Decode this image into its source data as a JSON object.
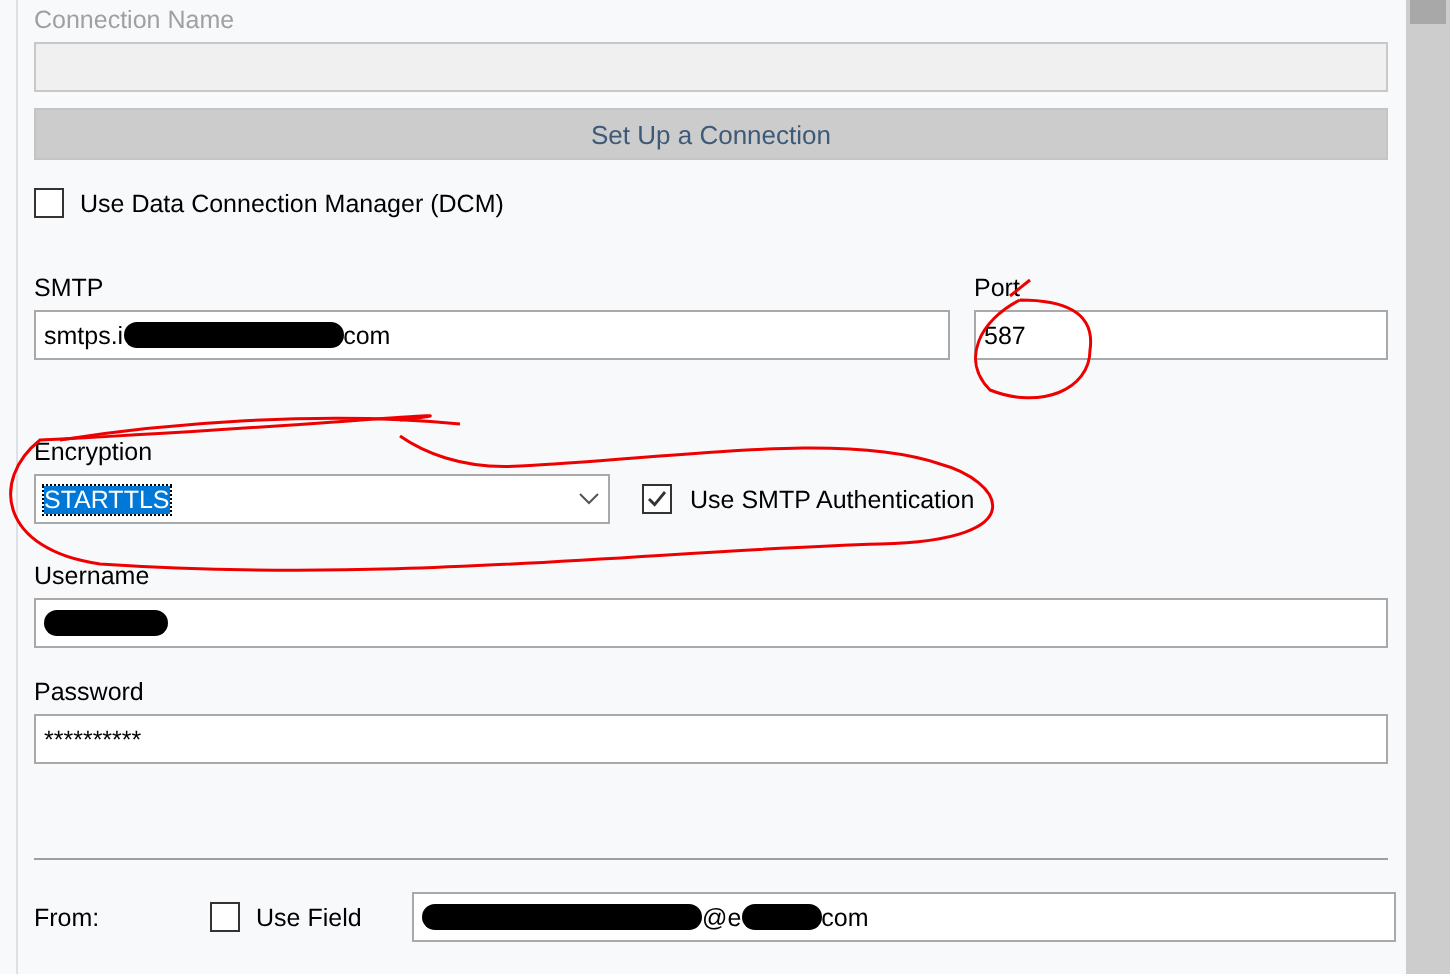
{
  "connection_name": {
    "label": "Connection Name",
    "disabled": true
  },
  "setup_button": {
    "label": "Set Up a Connection",
    "disabled": true
  },
  "dcm": {
    "label": "Use Data Connection Manager (DCM)",
    "checked": false
  },
  "smtp": {
    "label": "SMTP",
    "value_start": "smtps.i",
    "value_end": "com"
  },
  "port": {
    "label": "Port",
    "value": "587"
  },
  "encryption": {
    "label": "Encryption",
    "value": "STARTTLS",
    "text_selected": true
  },
  "smtp_auth": {
    "label": "Use SMTP Authentication",
    "checked": true
  },
  "username": {
    "label": "Username"
  },
  "password": {
    "label": "Password",
    "value": "**********"
  },
  "from": {
    "label": "From:",
    "use_field": {
      "label": "Use Field",
      "checked": false
    },
    "value_end_parts": [
      "@e",
      "com"
    ]
  }
}
